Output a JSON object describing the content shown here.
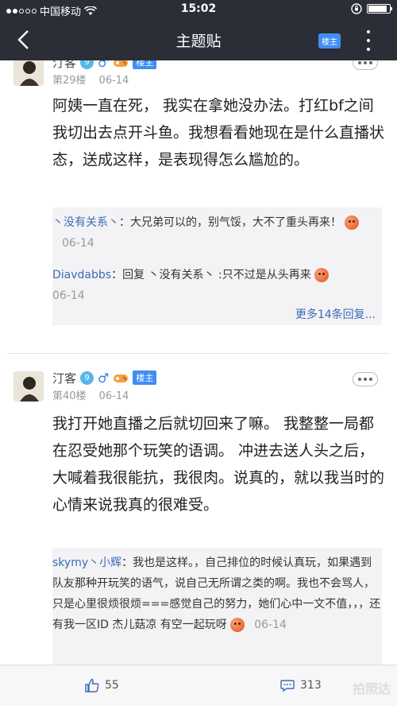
{
  "status": {
    "carrier": "中国移动",
    "time": "15:02"
  },
  "nav": {
    "title": "主题贴",
    "owner_button": "楼主"
  },
  "posts": [
    {
      "username": "汀客",
      "level": "9",
      "owner_badge": "楼主",
      "floor": "第29楼",
      "date": "06-14",
      "text": "阿姨一直在死， 我实在拿她没办法。打红bf之间我切出去点开斗鱼。我想看看她现在是什么直播状态，送成这样，是表现得怎么尴尬的。",
      "replies": [
        {
          "name": "丶没有关系丶",
          "text": "：大兄弟可以的，别气馁，大不了重头再来！",
          "date": "06-14"
        },
        {
          "name": "Diavdabbs",
          "text": "：回复 丶没有关系丶 :只不过是从头再来",
          "date": "06-14"
        }
      ],
      "more_replies": "更多14条回复..."
    },
    {
      "username": "汀客",
      "level": "9",
      "owner_badge": "楼主",
      "floor": "第40楼",
      "date": "06-14",
      "text": "我打开她直播之后就切回来了嘛。 我整整一局都在忍受她那个玩笑的语调。 冲进去送人头之后，大喊着我很能抗，我很肉。说真的，就以我当时的心情来说我真的很难受。",
      "replies": [
        {
          "name": "skymy丶小辉",
          "text": "：我也是这样。，自己排位的时候认真玩，如果遇到队友那种开玩笑的语气，说自己无所谓之类的啊。我也不会骂人，只是心里很烦很烦===感觉自己的努力，她们心中一文不值，，，还有我一区ID 杰儿菇凉 有空一起玩呀",
          "date": "06-14"
        }
      ]
    }
  ],
  "bottom": {
    "likes": "55",
    "comments": "313",
    "watermark": "拍照达"
  }
}
